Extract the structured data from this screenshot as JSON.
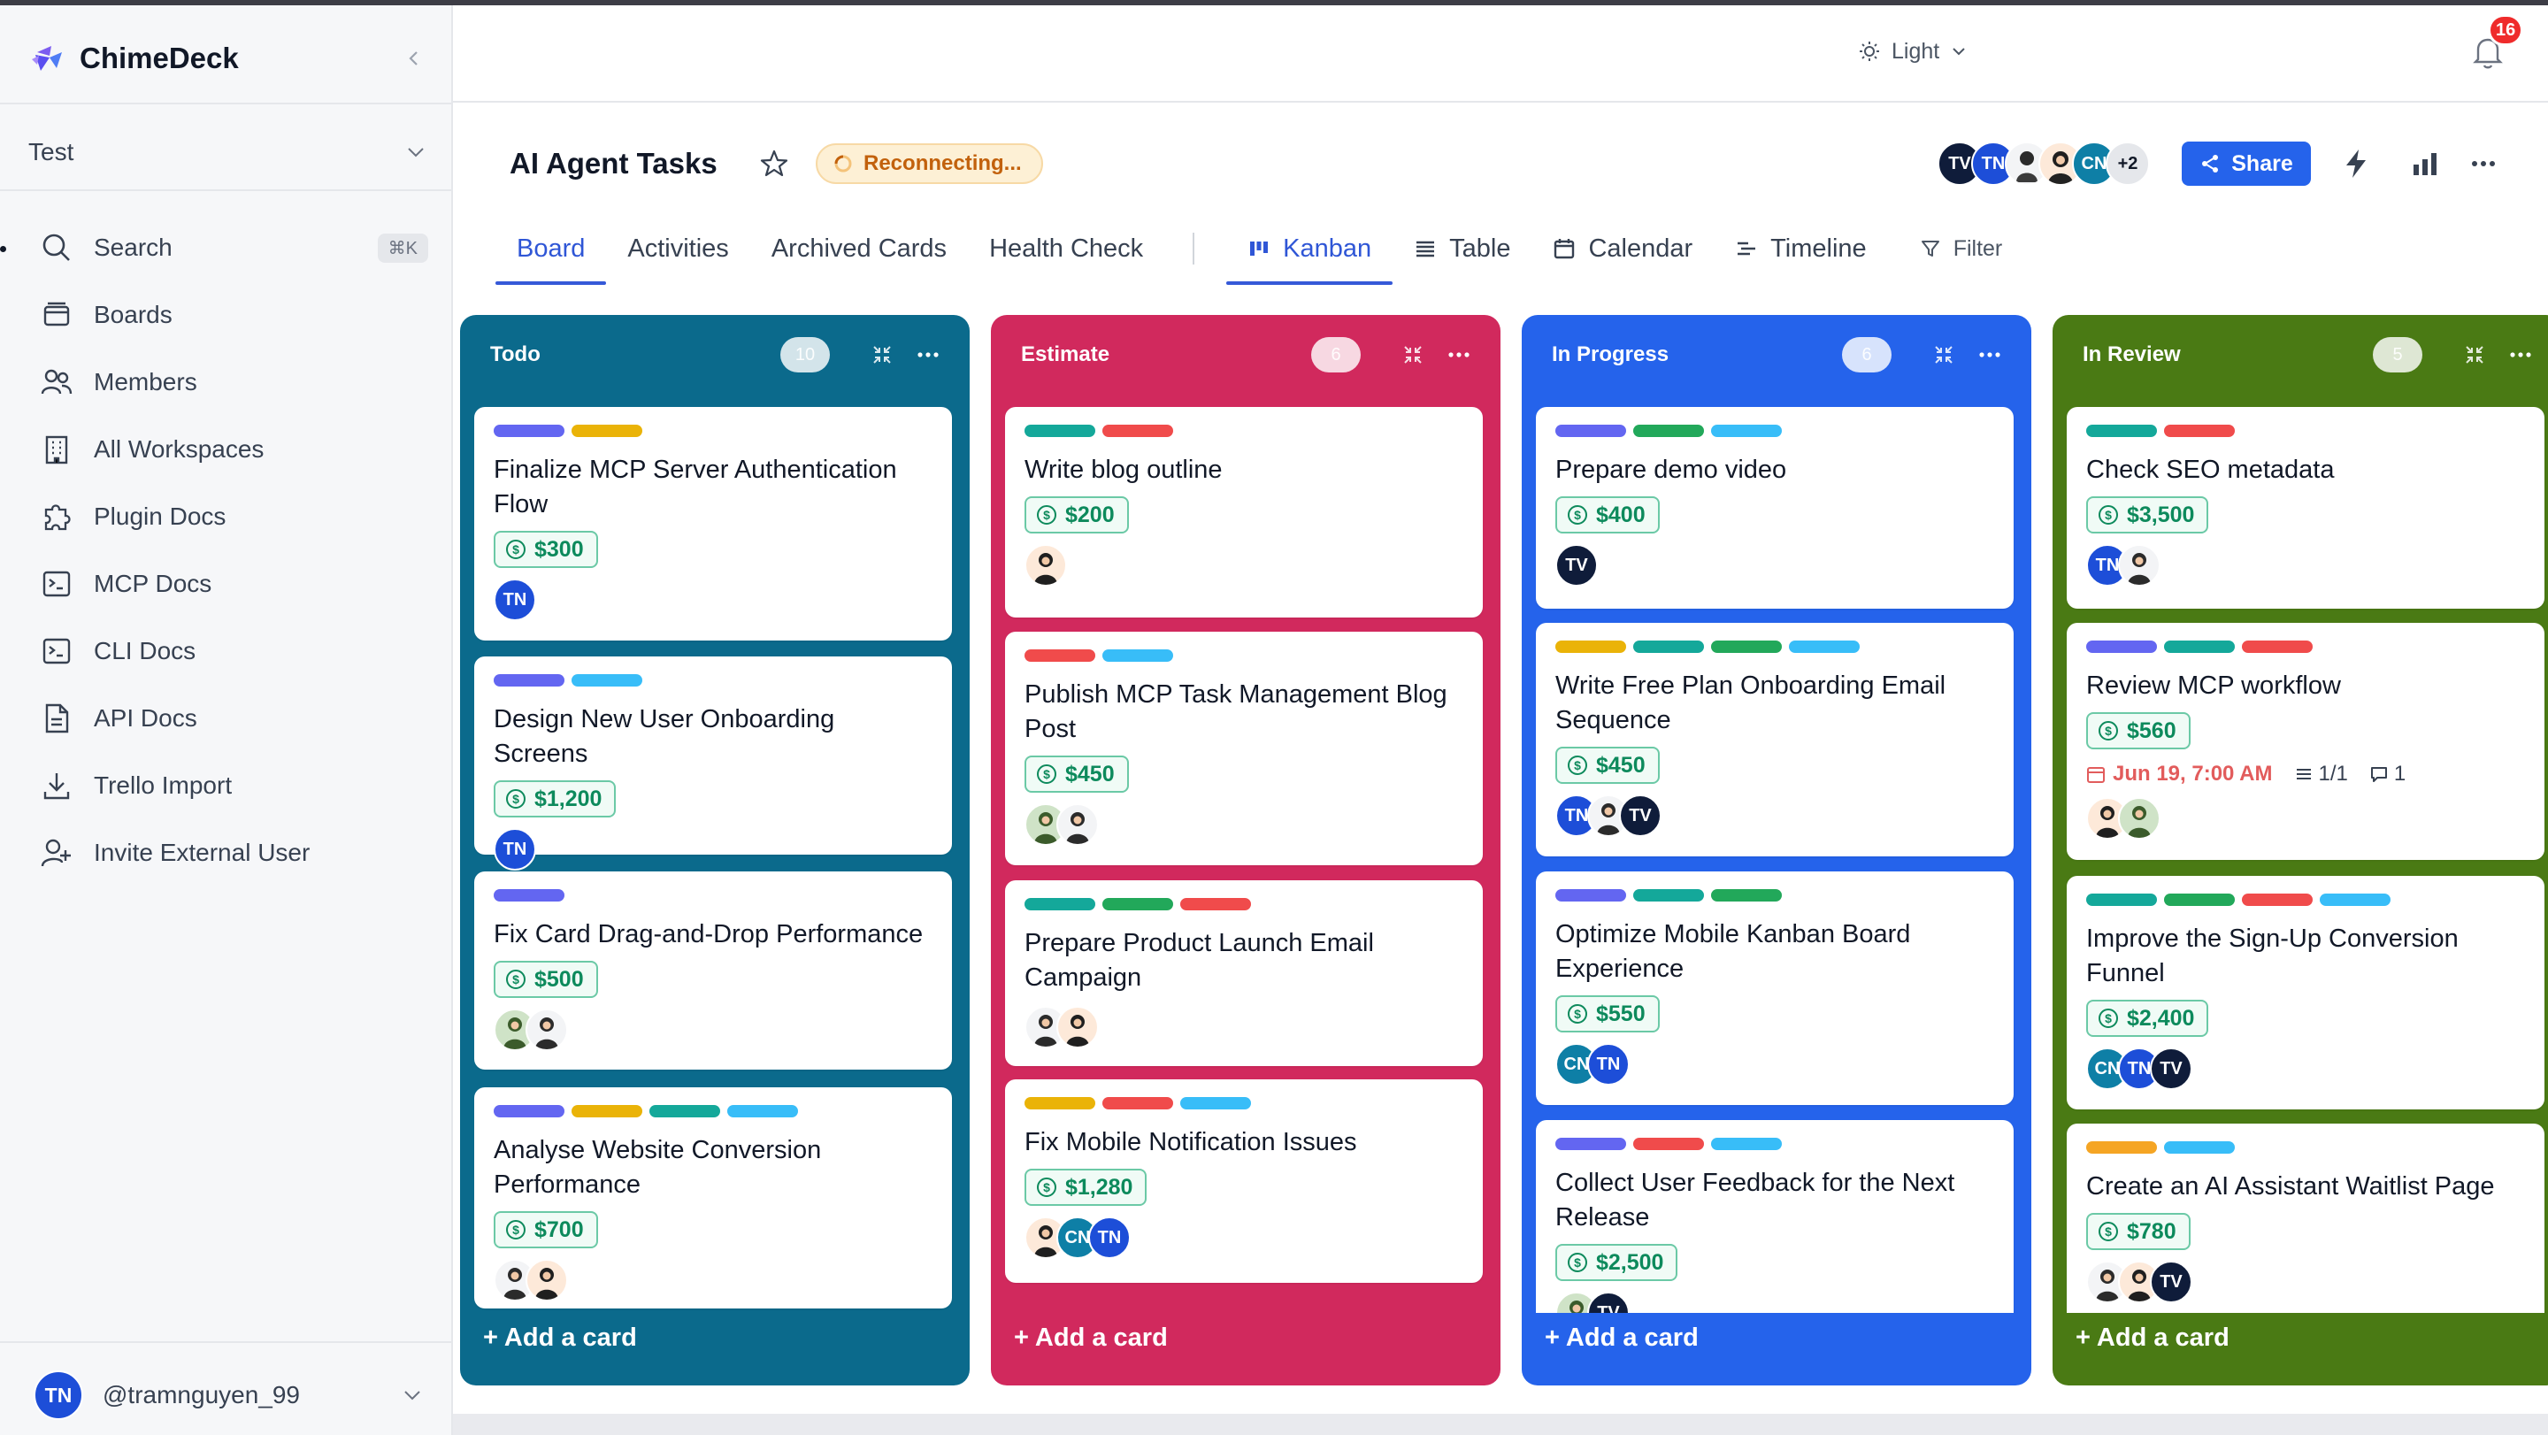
{
  "app": {
    "name": "ChimeDeck"
  },
  "sidebar": {
    "workspace": "Test",
    "search_shortcut": "⌘K",
    "items": [
      {
        "label": "Search",
        "icon": "search-icon"
      },
      {
        "label": "Boards",
        "icon": "boards-icon"
      },
      {
        "label": "Members",
        "icon": "members-icon"
      },
      {
        "label": "All Workspaces",
        "icon": "building-icon"
      },
      {
        "label": "Plugin Docs",
        "icon": "puzzle-icon"
      },
      {
        "label": "MCP Docs",
        "icon": "terminal-icon"
      },
      {
        "label": "CLI Docs",
        "icon": "terminal-icon"
      },
      {
        "label": "API Docs",
        "icon": "document-icon"
      },
      {
        "label": "Trello Import",
        "icon": "download-icon"
      },
      {
        "label": "Invite External User",
        "icon": "user-plus-icon"
      }
    ],
    "user": {
      "initials": "TN",
      "handle": "@tramnguyen_99"
    }
  },
  "topbar": {
    "theme_label": "Light",
    "notification_count": "16"
  },
  "board": {
    "title": "AI Agent Tasks",
    "status": "Reconnecting...",
    "share_label": "Share",
    "members": [
      "TV",
      "TN",
      "",
      "",
      "CN",
      "+2"
    ],
    "tabs": [
      "Board",
      "Activities",
      "Archived Cards",
      "Health Check"
    ],
    "views": [
      "Kanban",
      "Table",
      "Calendar",
      "Timeline"
    ],
    "filter_label": "Filter",
    "add_card_label": "+ Add a card"
  },
  "colors": {
    "todo": "#0b6a8c",
    "estimate": "#d1295d",
    "in_progress": "#2563eb",
    "in_review": "#4a7a14",
    "purple": "#6366f1",
    "yellow": "#eab308",
    "teal": "#14a89a",
    "green": "#22a85a",
    "red": "#f04b4b",
    "sky": "#38bdf8",
    "orange": "#f5a524"
  },
  "columns": [
    {
      "title": "Todo",
      "count": "10",
      "cards": [
        {
          "title": "Finalize MCP Server Authentication Flow",
          "price": "$300",
          "labels": [
            "purple",
            "yellow"
          ],
          "avatars": [
            "TN"
          ]
        },
        {
          "title": "Design New User Onboarding Screens",
          "price": "$1,200",
          "labels": [
            "purple",
            "sky"
          ],
          "avatars": [
            "TN"
          ]
        },
        {
          "title": "Fix Card Drag-and-Drop Performance",
          "price": "$500",
          "labels": [
            "purple"
          ],
          "avatars": [
            "",
            ""
          ]
        },
        {
          "title": "Analyse Website Conversion Performance",
          "price": "$700",
          "labels": [
            "purple",
            "yellow",
            "teal",
            "sky"
          ],
          "avatars": [
            "",
            ""
          ]
        }
      ]
    },
    {
      "title": "Estimate",
      "count": "6",
      "cards": [
        {
          "title": "Write blog outline",
          "price": "$200",
          "labels": [
            "teal",
            "red"
          ],
          "avatars": [
            ""
          ]
        },
        {
          "title": "Publish MCP Task Management Blog Post",
          "price": "$450",
          "labels": [
            "red",
            "sky"
          ],
          "avatars": [
            "",
            ""
          ]
        },
        {
          "title": "Prepare Product Launch Email Campaign",
          "price": "",
          "labels": [
            "teal",
            "green",
            "red"
          ],
          "avatars": [
            "",
            ""
          ]
        },
        {
          "title": "Fix Mobile Notification Issues",
          "price": "$1,280",
          "labels": [
            "yellow",
            "red",
            "sky"
          ],
          "avatars": [
            "",
            "CN",
            "TN"
          ]
        }
      ]
    },
    {
      "title": "In Progress",
      "count": "6",
      "cards": [
        {
          "title": "Prepare demo video",
          "price": "$400",
          "labels": [
            "purple",
            "green",
            "sky"
          ],
          "avatars": [
            "TV"
          ]
        },
        {
          "title": "Write Free Plan Onboarding Email Sequence",
          "price": "$450",
          "labels": [
            "yellow",
            "teal",
            "green",
            "sky"
          ],
          "avatars": [
            "TN",
            "",
            "TV"
          ]
        },
        {
          "title": "Optimize Mobile Kanban Board Experience",
          "price": "$550",
          "labels": [
            "purple",
            "teal",
            "green"
          ],
          "avatars": [
            "CN",
            "TN"
          ]
        },
        {
          "title": "Collect User Feedback for the Next Release",
          "price": "$2,500",
          "labels": [
            "purple",
            "red",
            "sky"
          ],
          "avatars": [
            "",
            "TV"
          ]
        }
      ]
    },
    {
      "title": "In Review",
      "count": "5",
      "cards": [
        {
          "title": "Check SEO metadata",
          "price": "$3,500",
          "labels": [
            "teal",
            "red"
          ],
          "avatars": [
            "TN",
            ""
          ]
        },
        {
          "title": "Review MCP workflow",
          "price": "$560",
          "labels": [
            "purple",
            "teal",
            "red"
          ],
          "avatars": [
            "",
            ""
          ],
          "due": "Jun 19, 7:00 AM",
          "checklist": "1/1",
          "comments": "1"
        },
        {
          "title": "Improve the Sign-Up Conversion Funnel",
          "price": "$2,400",
          "labels": [
            "teal",
            "green",
            "red",
            "sky"
          ],
          "avatars": [
            "CN",
            "TN",
            "TV"
          ]
        },
        {
          "title": "Create an AI Assistant Waitlist Page",
          "price": "$780",
          "labels": [
            "orange",
            "sky"
          ],
          "avatars": [
            "",
            "",
            "TV"
          ]
        }
      ]
    }
  ]
}
